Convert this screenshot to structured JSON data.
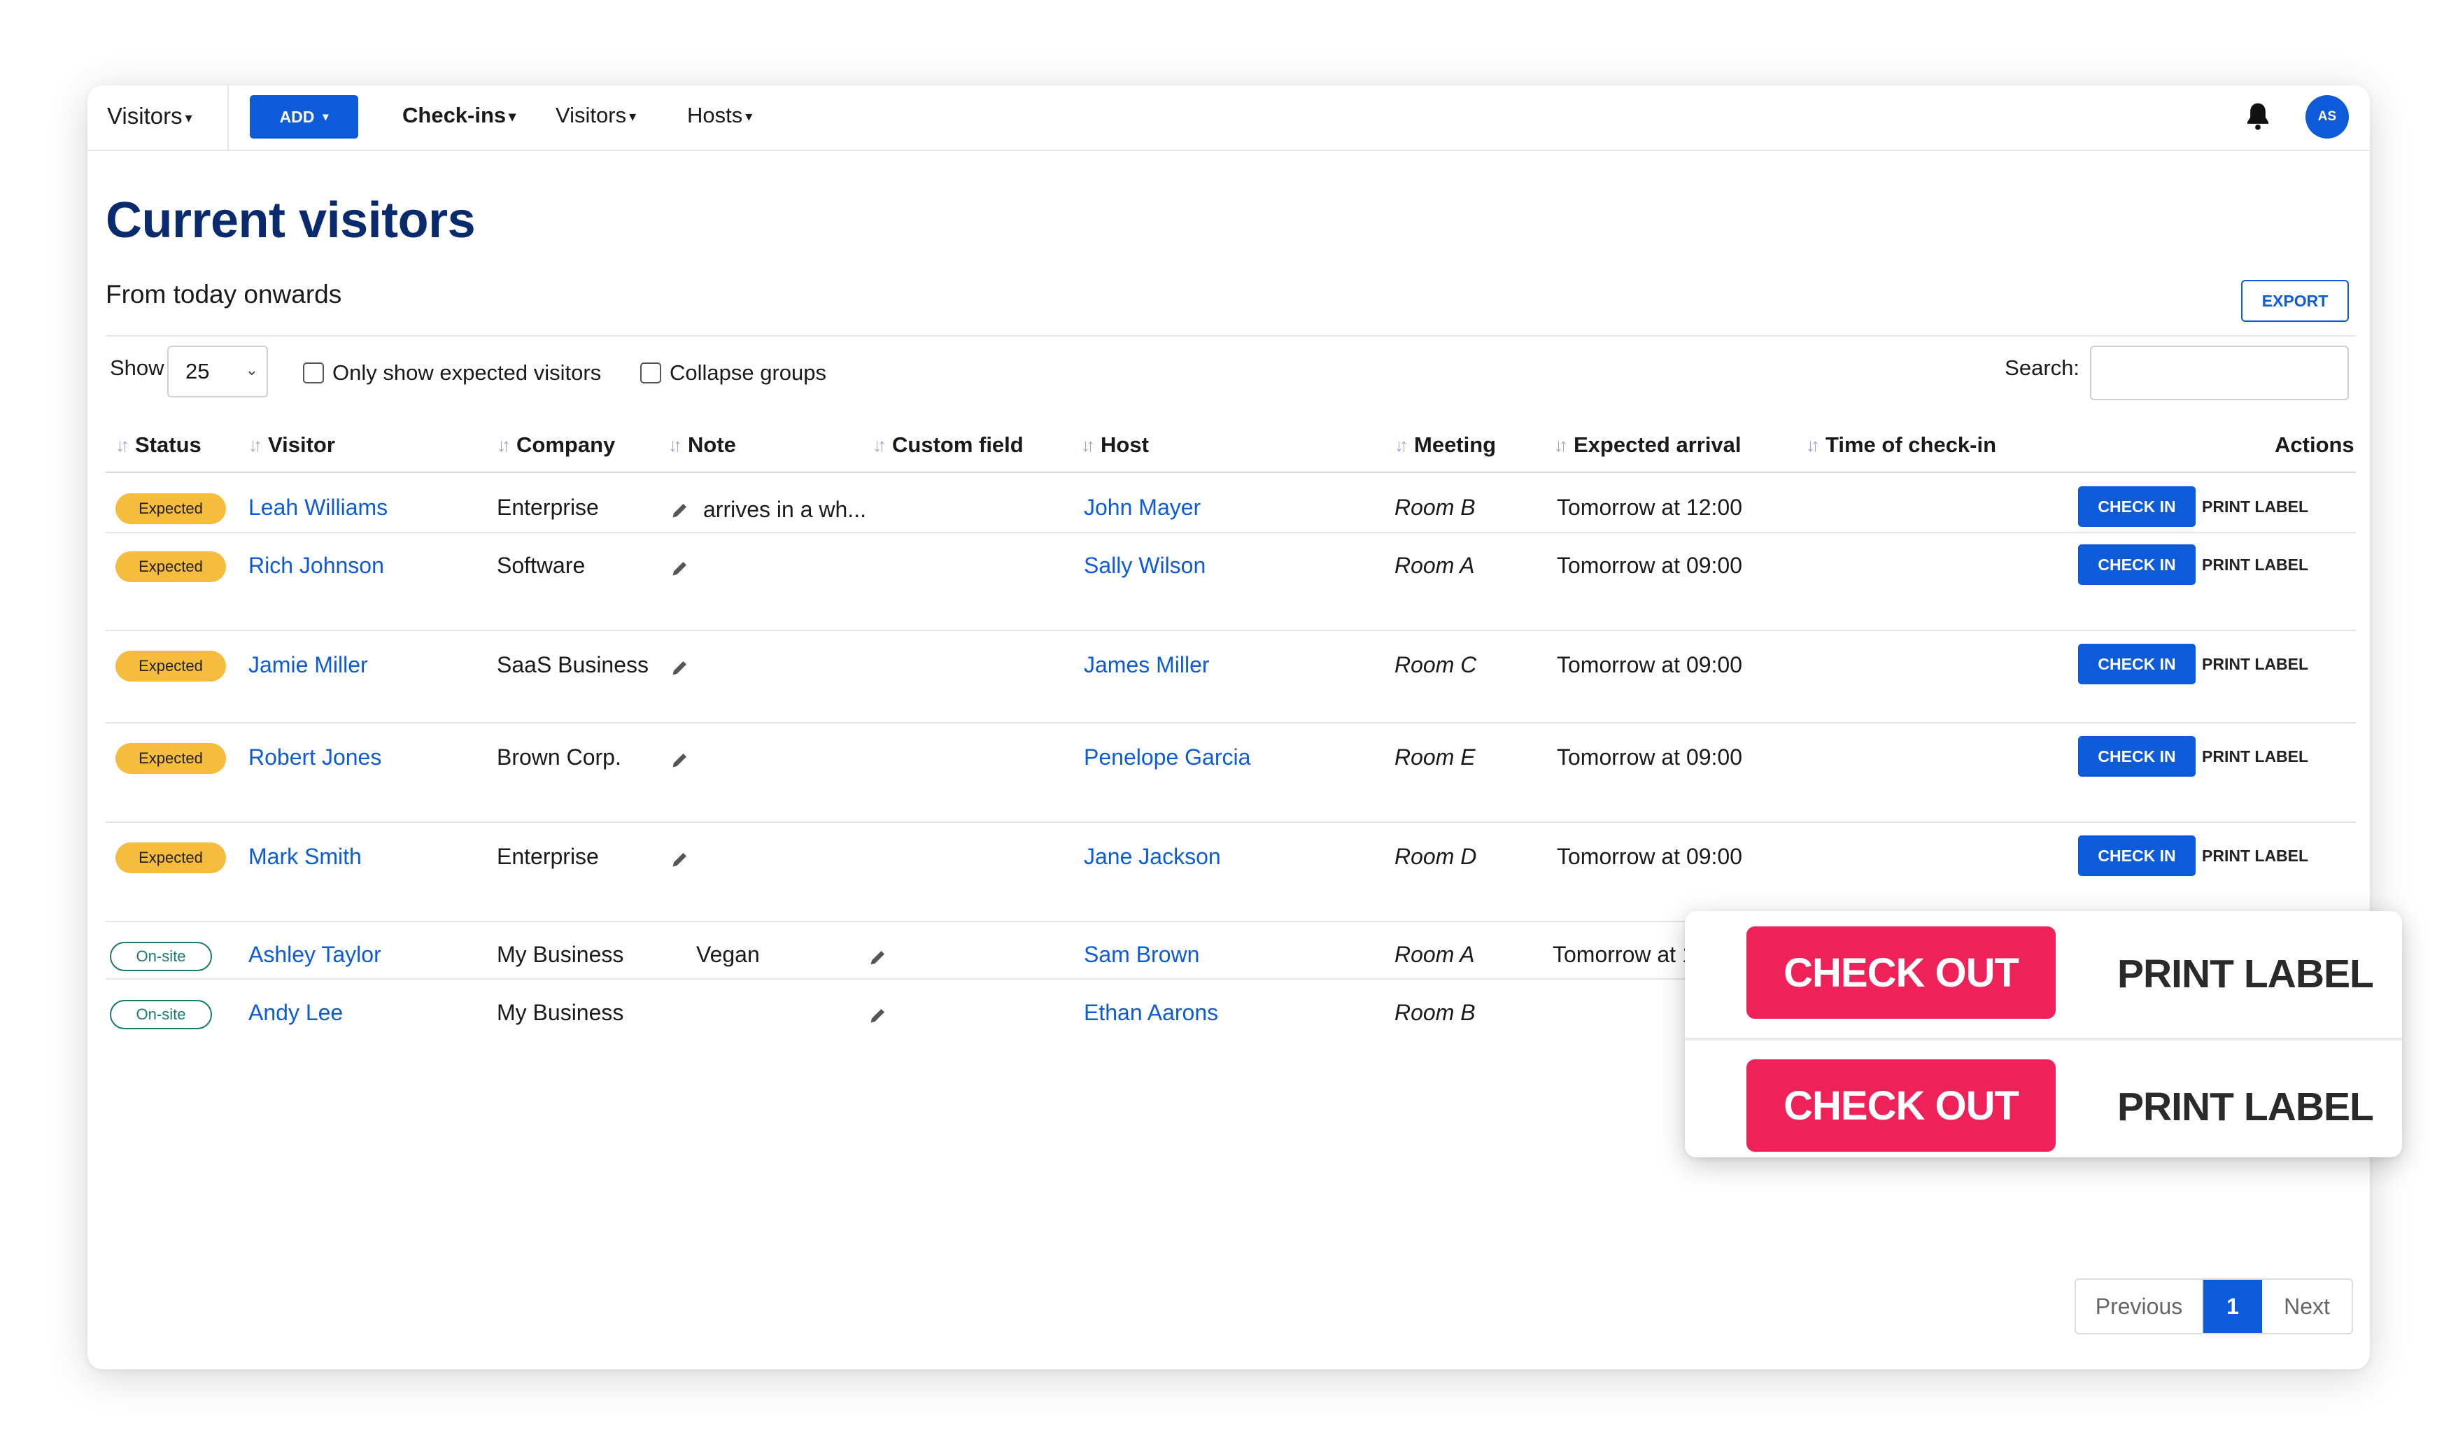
{
  "topbar": {
    "brand": "Visitors",
    "add_label": "ADD",
    "nav": [
      "Check-ins",
      "Visitors",
      "Hosts"
    ],
    "avatar_initials": "AS"
  },
  "page": {
    "title": "Current visitors",
    "subtitle": "From today onwards",
    "export_label": "EXPORT"
  },
  "filters": {
    "show_label": "Show",
    "show_value": "25",
    "only_expected_label": "Only show expected visitors",
    "collapse_groups_label": "Collapse groups",
    "search_label": "Search:"
  },
  "table": {
    "headers": [
      "Status",
      "Visitor",
      "Company",
      "Note",
      "Custom field",
      "Host",
      "Meeting",
      "Expected arrival",
      "Time of check-in",
      "Actions"
    ],
    "rows": [
      {
        "status": "Expected",
        "visitor": "Leah Williams",
        "company": "Enterprise",
        "note": "arrives in a wh...",
        "custom": "",
        "host": "John Mayer",
        "meeting": "Room B",
        "arrival": "Tomorrow at 12:00"
      },
      {
        "status": "Expected",
        "visitor": "Rich Johnson",
        "company": "Software",
        "note": "",
        "custom": "",
        "host": "Sally Wilson",
        "meeting": "Room A",
        "arrival": "Tomorrow at 09:00"
      },
      {
        "status": "Expected",
        "visitor": "Jamie Miller",
        "company": "SaaS Business",
        "note": "",
        "custom": "",
        "host": "James Miller",
        "meeting": "Room C",
        "arrival": "Tomorrow at 09:00"
      },
      {
        "status": "Expected",
        "visitor": "Robert Jones",
        "company": "Brown Corp.",
        "note": "",
        "custom": "",
        "host": "Penelope Garcia",
        "meeting": "Room E",
        "arrival": "Tomorrow at 09:00"
      },
      {
        "status": "Expected",
        "visitor": "Mark Smith",
        "company": "Enterprise",
        "note": "",
        "custom": "",
        "host": "Jane Jackson",
        "meeting": "Room D",
        "arrival": "Tomorrow at 09:00"
      },
      {
        "status": "On-site",
        "visitor": "Ashley Taylor",
        "company": "My Business",
        "note": "Vegan",
        "custom": "",
        "host": "Sam Brown",
        "meeting": "Room A",
        "arrival": "Tomorrow at 13"
      },
      {
        "status": "On-site",
        "visitor": "Andy Lee",
        "company": "My Business",
        "note": "",
        "custom": "",
        "host": "Ethan Aarons",
        "meeting": "Room B",
        "arrival": ""
      }
    ],
    "checkin_label": "CHECK IN",
    "print_label": "PRINT LABEL"
  },
  "popup": {
    "checkout_label": "CHECK OUT",
    "print_label": "PRINT LABEL"
  },
  "pagination": {
    "previous": "Previous",
    "current": "1",
    "next": "Next"
  },
  "colors": {
    "primary": "#0d5bd9",
    "title": "#0a2a6e",
    "expected_badge": "#f6bc3d",
    "onsite_badge": "#1a7a6e",
    "checkout": "#ee2158"
  }
}
